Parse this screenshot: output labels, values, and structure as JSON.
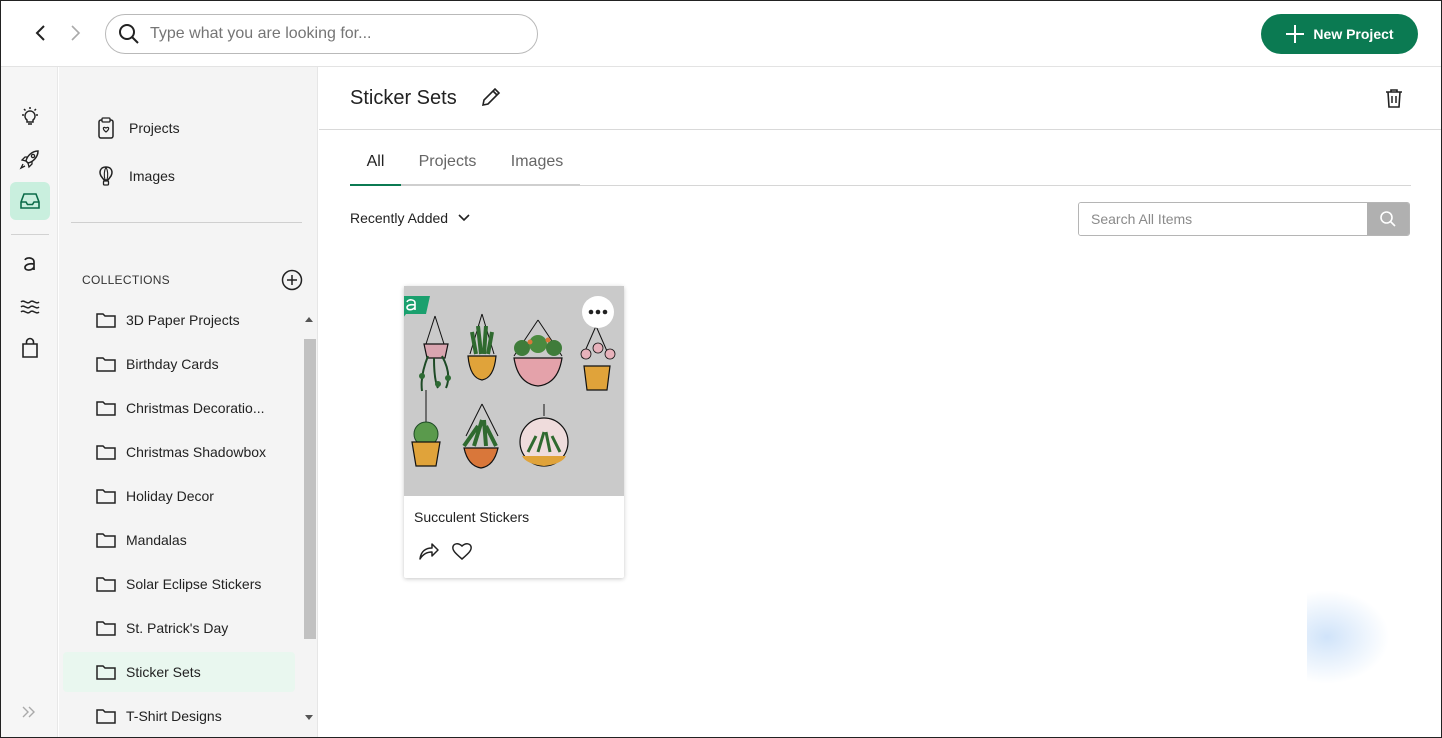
{
  "topbar": {
    "search_placeholder": "Type what you are looking for...",
    "new_project_label": "New Project"
  },
  "sidebar": {
    "links": [
      {
        "label": "Projects",
        "icon": "projects-icon"
      },
      {
        "label": "Images",
        "icon": "images-icon"
      }
    ],
    "collections_title": "COLLECTIONS",
    "collections": [
      "3D Paper Projects",
      "Birthday Cards",
      "Christmas Decoratio...",
      "Christmas Shadowbox",
      "Holiday Decor",
      "Mandalas",
      "Solar Eclipse Stickers",
      "St. Patrick's Day",
      "Sticker Sets",
      "T-Shirt Designs"
    ],
    "active_collection": "Sticker Sets"
  },
  "main": {
    "title": "Sticker Sets",
    "tabs": [
      {
        "label": "All",
        "active": true
      },
      {
        "label": "Projects",
        "active": false
      },
      {
        "label": "Images",
        "active": false
      }
    ],
    "sort_label": "Recently Added",
    "search_placeholder": "Search All Items",
    "items": [
      {
        "title": "Succulent Stickers",
        "badge": "a"
      }
    ]
  },
  "colors": {
    "brand_green": "#0b7a52",
    "active_rail_bg": "#c9efde",
    "active_collection_bg": "#e9f7ef",
    "card_image_bg": "#cacaca"
  }
}
